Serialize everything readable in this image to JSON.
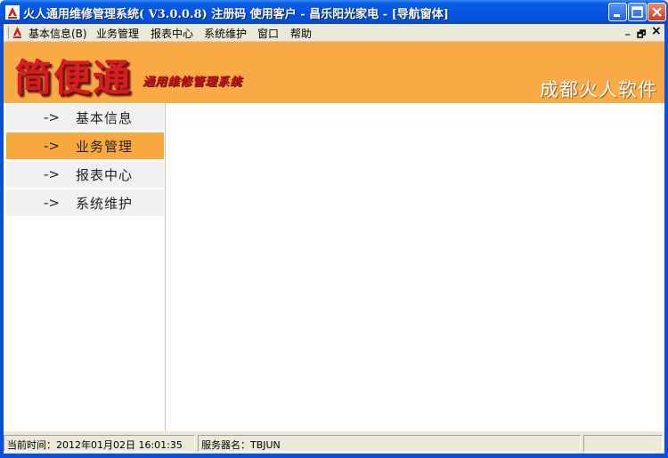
{
  "window": {
    "title": "火人通用维修管理系统( V3.0.0.8) 注册码 使用客户 - 昌乐阳光家电 - [导航窗体]"
  },
  "menu": {
    "items": [
      "基本信息(B)",
      "业务管理",
      "报表中心",
      "系统维护",
      "窗口",
      "帮助"
    ]
  },
  "mdi_controls": {
    "minimize": "_",
    "restore": "🗗",
    "close": "×"
  },
  "banner": {
    "logo": "简便通",
    "slogan": "通用维修管理系统",
    "company": "成都火人软件"
  },
  "nav": {
    "arrow": "->",
    "items": [
      {
        "label": "基本信息",
        "active": false
      },
      {
        "label": "业务管理",
        "active": true
      },
      {
        "label": "报表中心",
        "active": false
      },
      {
        "label": "系统维护",
        "active": false
      }
    ]
  },
  "status": {
    "time": "当前时间：2012年01月02日 16:01:35",
    "server": "服务器名：TBJUN",
    "extra": ""
  },
  "colors": {
    "banner": "#fbaa48",
    "active_nav": "#f9a83e",
    "logo": "#d61e1e"
  }
}
